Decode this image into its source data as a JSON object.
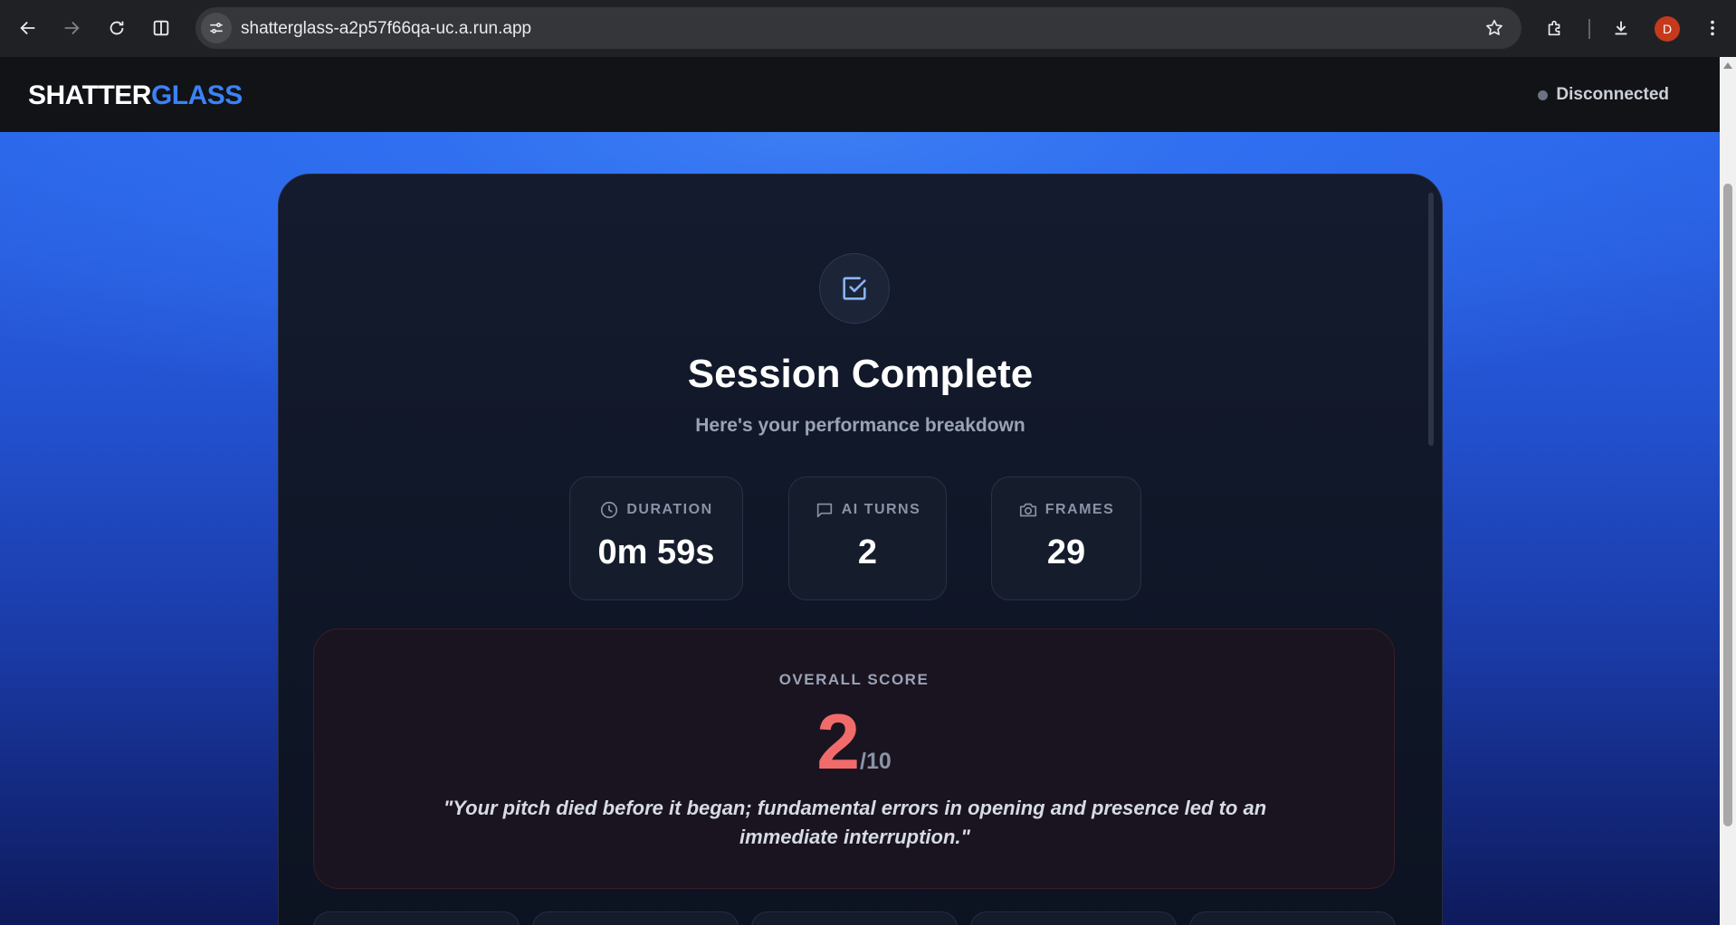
{
  "browser": {
    "url": "shatterglass-a2p57f66qa-uc.a.run.app",
    "profile_initial": "D"
  },
  "header": {
    "logo_part1": "SHATTER",
    "logo_part2": "GLASS",
    "status": "Disconnected"
  },
  "summary": {
    "title": "Session Complete",
    "subtitle": "Here's your performance breakdown",
    "stats": [
      {
        "label": "DURATION",
        "value": "0m 59s",
        "icon": "clock-icon"
      },
      {
        "label": "AI TURNS",
        "value": "2",
        "icon": "chat-bubble-icon"
      },
      {
        "label": "FRAMES",
        "value": "29",
        "icon": "camera-icon"
      }
    ]
  },
  "score": {
    "label": "OVERALL SCORE",
    "value": "2",
    "max": "/10",
    "quote": "\"Your pitch died before it began; fundamental errors in opening and presence led to an immediate interruption.\""
  },
  "colors": {
    "accent": "#3b82f6",
    "score": "#f26b6b",
    "status_dot": "#6b7280"
  }
}
